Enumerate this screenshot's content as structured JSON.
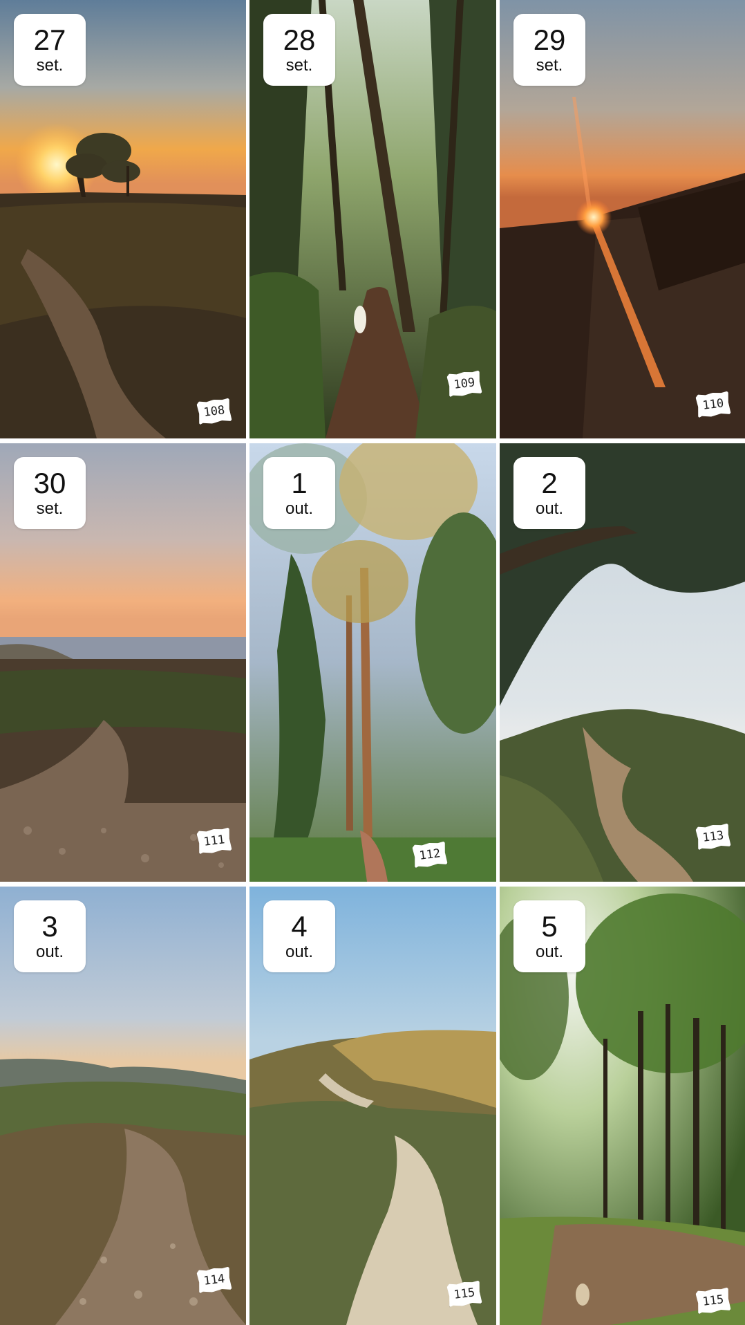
{
  "tiles": [
    {
      "day": "27",
      "month": "set.",
      "sticker": "108",
      "scene": "sunset-tree-trail"
    },
    {
      "day": "28",
      "month": "set.",
      "sticker": "109",
      "scene": "forest-path-dog"
    },
    {
      "day": "29",
      "month": "set.",
      "sticker": "110",
      "scene": "sunset-sun-flare"
    },
    {
      "day": "30",
      "month": "set.",
      "sticker": "111",
      "scene": "dusk-coast-gravel"
    },
    {
      "day": "1",
      "month": "out.",
      "sticker": "112",
      "scene": "tall-pine-forest"
    },
    {
      "day": "2",
      "month": "out.",
      "sticker": "113",
      "scene": "eucalyptus-hill"
    },
    {
      "day": "3",
      "month": "out.",
      "sticker": "114",
      "scene": "valley-gravel-path"
    },
    {
      "day": "4",
      "month": "out.",
      "sticker": "115",
      "scene": "hill-dirt-road"
    },
    {
      "day": "5",
      "month": "out.",
      "sticker": "115",
      "scene": "sunny-forest-path"
    }
  ],
  "colors": {
    "badge_bg": "#ffffff",
    "badge_text": "#111111",
    "divider": "#ffffff"
  }
}
